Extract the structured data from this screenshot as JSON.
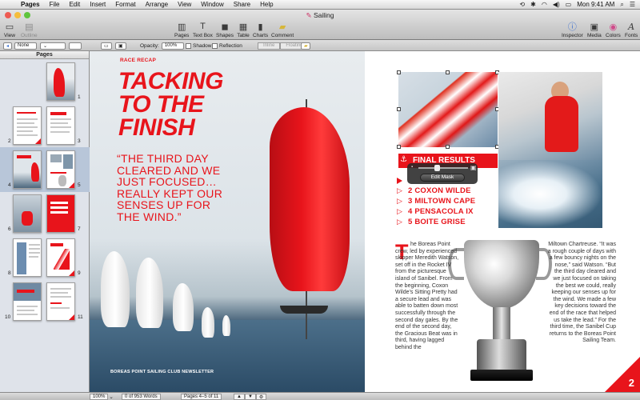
{
  "menubar": {
    "app_name": "Pages",
    "items": [
      "File",
      "Edit",
      "Insert",
      "Format",
      "Arrange",
      "View",
      "Window",
      "Share",
      "Help"
    ],
    "clock": "Mon 9:41 AM"
  },
  "window": {
    "title": "Sailing"
  },
  "toolbar": {
    "left": [
      {
        "label": "View",
        "icon": "view-icon"
      },
      {
        "label": "Outline",
        "icon": "outline-icon"
      }
    ],
    "center": [
      {
        "label": "Pages",
        "icon": "pages-icon"
      },
      {
        "label": "Text Box",
        "icon": "text-box-icon"
      },
      {
        "label": "Shapes",
        "icon": "shapes-icon"
      },
      {
        "label": "Table",
        "icon": "table-icon"
      },
      {
        "label": "Charts",
        "icon": "charts-icon"
      },
      {
        "label": "Comment",
        "icon": "comment-icon"
      }
    ],
    "right": [
      {
        "label": "Inspector",
        "icon": "inspector-icon"
      },
      {
        "label": "Media",
        "icon": "media-icon"
      },
      {
        "label": "Colors",
        "icon": "colors-icon"
      },
      {
        "label": "Fonts",
        "icon": "fonts-icon"
      }
    ]
  },
  "formatbar": {
    "style_value": "None",
    "opacity_label": "Opacity:",
    "opacity_value": "100%",
    "shadow_label": "Shadow",
    "reflection_label": "Reflection",
    "inline_label": "Inline",
    "floating_label": "Floating"
  },
  "sidebar": {
    "header": "Pages",
    "page_numbers": [
      "1",
      "2",
      "3",
      "4",
      "5",
      "6",
      "7",
      "8",
      "9",
      "10",
      "11"
    ]
  },
  "left_page": {
    "kicker": "RACE RECAP",
    "headline_lines": [
      "TACKING",
      "TO THE",
      "FINISH"
    ],
    "quote": "“THE THIRD DAY CLEARED AND WE JUST FOCUSED… REALLY KEPT OUR SENSES UP FOR THE WIND.”",
    "footer": "BOREAS POINT SAILING CLUB NEWSLETTER"
  },
  "right_page": {
    "results_title": "FINAL RESULTS",
    "mask_button": "Edit Mask",
    "results": [
      "1",
      "2 COXON WILDE",
      "3 MILTOWN CAPE",
      "4 PENSACOLA IX",
      "5 BOITE GRISE"
    ],
    "drop_cap": "T",
    "col1": "he Boreas Point crew, led by experienced skipper Meredith Watson, set off in the Rocket IV from the picturesque island of Sanibel. From the beginning, Coxon Wilde’s Sitting Pretty had a secure lead and was able to batten down most successfully through the second day gales. By the end of the second day, the Gracious Beat was in third, having lagged behind the",
    "col2": "Miltown Chartreuse. “It was a rough couple of days with a few bouncy nights on the nose,” said Watson. “But the third day cleared and we just focused on taking the best we could, really keeping our senses up for the wind. We made a few key decisions toward the end of the race that helped us take the lead.” For the third time, the Sanibel Cup returns to the Boreas Point Sailing Team.",
    "page_number": "2"
  },
  "statusbar": {
    "zoom": "100%",
    "word_count": "0 of 953 Words",
    "page_range": "Pages 4–5 of 11"
  },
  "colors": {
    "accent_red": "#e8141b"
  }
}
